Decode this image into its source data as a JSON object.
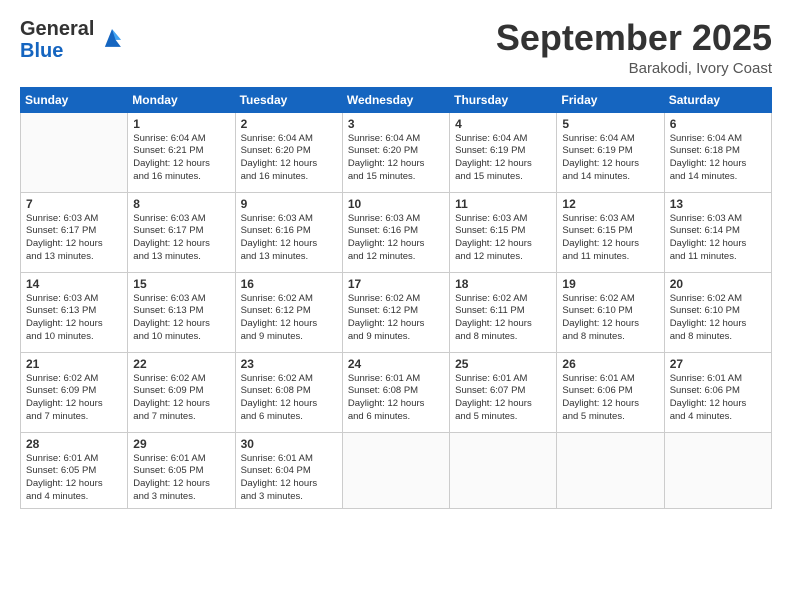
{
  "logo": {
    "general": "General",
    "blue": "Blue"
  },
  "title": "September 2025",
  "location": "Barakodi, Ivory Coast",
  "weekdays": [
    "Sunday",
    "Monday",
    "Tuesday",
    "Wednesday",
    "Thursday",
    "Friday",
    "Saturday"
  ],
  "weeks": [
    [
      {
        "day": "",
        "info": ""
      },
      {
        "day": "1",
        "info": "Sunrise: 6:04 AM\nSunset: 6:21 PM\nDaylight: 12 hours\nand 16 minutes."
      },
      {
        "day": "2",
        "info": "Sunrise: 6:04 AM\nSunset: 6:20 PM\nDaylight: 12 hours\nand 16 minutes."
      },
      {
        "day": "3",
        "info": "Sunrise: 6:04 AM\nSunset: 6:20 PM\nDaylight: 12 hours\nand 15 minutes."
      },
      {
        "day": "4",
        "info": "Sunrise: 6:04 AM\nSunset: 6:19 PM\nDaylight: 12 hours\nand 15 minutes."
      },
      {
        "day": "5",
        "info": "Sunrise: 6:04 AM\nSunset: 6:19 PM\nDaylight: 12 hours\nand 14 minutes."
      },
      {
        "day": "6",
        "info": "Sunrise: 6:04 AM\nSunset: 6:18 PM\nDaylight: 12 hours\nand 14 minutes."
      }
    ],
    [
      {
        "day": "7",
        "info": "Sunrise: 6:03 AM\nSunset: 6:17 PM\nDaylight: 12 hours\nand 13 minutes."
      },
      {
        "day": "8",
        "info": "Sunrise: 6:03 AM\nSunset: 6:17 PM\nDaylight: 12 hours\nand 13 minutes."
      },
      {
        "day": "9",
        "info": "Sunrise: 6:03 AM\nSunset: 6:16 PM\nDaylight: 12 hours\nand 13 minutes."
      },
      {
        "day": "10",
        "info": "Sunrise: 6:03 AM\nSunset: 6:16 PM\nDaylight: 12 hours\nand 12 minutes."
      },
      {
        "day": "11",
        "info": "Sunrise: 6:03 AM\nSunset: 6:15 PM\nDaylight: 12 hours\nand 12 minutes."
      },
      {
        "day": "12",
        "info": "Sunrise: 6:03 AM\nSunset: 6:15 PM\nDaylight: 12 hours\nand 11 minutes."
      },
      {
        "day": "13",
        "info": "Sunrise: 6:03 AM\nSunset: 6:14 PM\nDaylight: 12 hours\nand 11 minutes."
      }
    ],
    [
      {
        "day": "14",
        "info": "Sunrise: 6:03 AM\nSunset: 6:13 PM\nDaylight: 12 hours\nand 10 minutes."
      },
      {
        "day": "15",
        "info": "Sunrise: 6:03 AM\nSunset: 6:13 PM\nDaylight: 12 hours\nand 10 minutes."
      },
      {
        "day": "16",
        "info": "Sunrise: 6:02 AM\nSunset: 6:12 PM\nDaylight: 12 hours\nand 9 minutes."
      },
      {
        "day": "17",
        "info": "Sunrise: 6:02 AM\nSunset: 6:12 PM\nDaylight: 12 hours\nand 9 minutes."
      },
      {
        "day": "18",
        "info": "Sunrise: 6:02 AM\nSunset: 6:11 PM\nDaylight: 12 hours\nand 8 minutes."
      },
      {
        "day": "19",
        "info": "Sunrise: 6:02 AM\nSunset: 6:10 PM\nDaylight: 12 hours\nand 8 minutes."
      },
      {
        "day": "20",
        "info": "Sunrise: 6:02 AM\nSunset: 6:10 PM\nDaylight: 12 hours\nand 8 minutes."
      }
    ],
    [
      {
        "day": "21",
        "info": "Sunrise: 6:02 AM\nSunset: 6:09 PM\nDaylight: 12 hours\nand 7 minutes."
      },
      {
        "day": "22",
        "info": "Sunrise: 6:02 AM\nSunset: 6:09 PM\nDaylight: 12 hours\nand 7 minutes."
      },
      {
        "day": "23",
        "info": "Sunrise: 6:02 AM\nSunset: 6:08 PM\nDaylight: 12 hours\nand 6 minutes."
      },
      {
        "day": "24",
        "info": "Sunrise: 6:01 AM\nSunset: 6:08 PM\nDaylight: 12 hours\nand 6 minutes."
      },
      {
        "day": "25",
        "info": "Sunrise: 6:01 AM\nSunset: 6:07 PM\nDaylight: 12 hours\nand 5 minutes."
      },
      {
        "day": "26",
        "info": "Sunrise: 6:01 AM\nSunset: 6:06 PM\nDaylight: 12 hours\nand 5 minutes."
      },
      {
        "day": "27",
        "info": "Sunrise: 6:01 AM\nSunset: 6:06 PM\nDaylight: 12 hours\nand 4 minutes."
      }
    ],
    [
      {
        "day": "28",
        "info": "Sunrise: 6:01 AM\nSunset: 6:05 PM\nDaylight: 12 hours\nand 4 minutes."
      },
      {
        "day": "29",
        "info": "Sunrise: 6:01 AM\nSunset: 6:05 PM\nDaylight: 12 hours\nand 3 minutes."
      },
      {
        "day": "30",
        "info": "Sunrise: 6:01 AM\nSunset: 6:04 PM\nDaylight: 12 hours\nand 3 minutes."
      },
      {
        "day": "",
        "info": ""
      },
      {
        "day": "",
        "info": ""
      },
      {
        "day": "",
        "info": ""
      },
      {
        "day": "",
        "info": ""
      }
    ]
  ]
}
